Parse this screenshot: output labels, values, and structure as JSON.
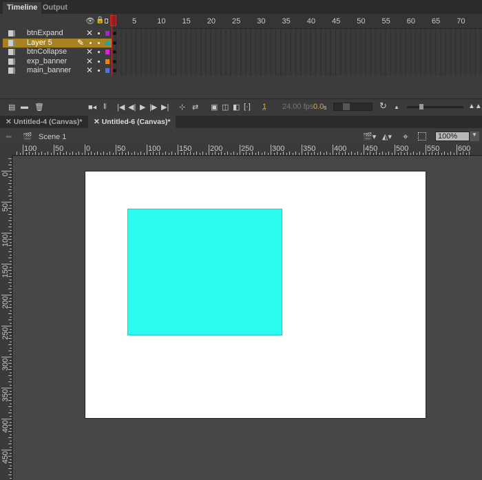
{
  "panel_tabs": [
    "Timeline",
    "Output"
  ],
  "frame_numbers": [
    "1",
    "5",
    "10",
    "15",
    "20",
    "25",
    "30",
    "35",
    "40",
    "45",
    "50",
    "55",
    "60",
    "65",
    "70"
  ],
  "layers": [
    {
      "name": "btnExpand",
      "color": "#b020d0",
      "selected": false
    },
    {
      "name": "Layer 5",
      "color": "#18a8a8",
      "selected": true
    },
    {
      "name": "btnCollapse",
      "color": "#e020e0",
      "selected": false
    },
    {
      "name": "exp_banner",
      "color": "#f08010",
      "selected": false
    },
    {
      "name": "main_banner",
      "color": "#5070f0",
      "selected": false
    }
  ],
  "controls": {
    "current_frame": "1",
    "fps": "24.00 fps",
    "time": "0.0",
    "time_unit": "s"
  },
  "doc_tabs": [
    "Untitled-4 (Canvas)*",
    "Untitled-6 (Canvas)*"
  ],
  "scene": {
    "label": "Scene 1",
    "zoom": "100%"
  },
  "shape_color": "#2bfaf0",
  "hruler_labels": [
    "100",
    "50",
    "0",
    "50",
    "100",
    "150",
    "200",
    "250",
    "300",
    "350",
    "400",
    "450",
    "500",
    "550",
    "600"
  ],
  "vruler_labels": [
    "0",
    "50",
    "100",
    "150",
    "200",
    "250",
    "300",
    "350",
    "400",
    "450"
  ]
}
